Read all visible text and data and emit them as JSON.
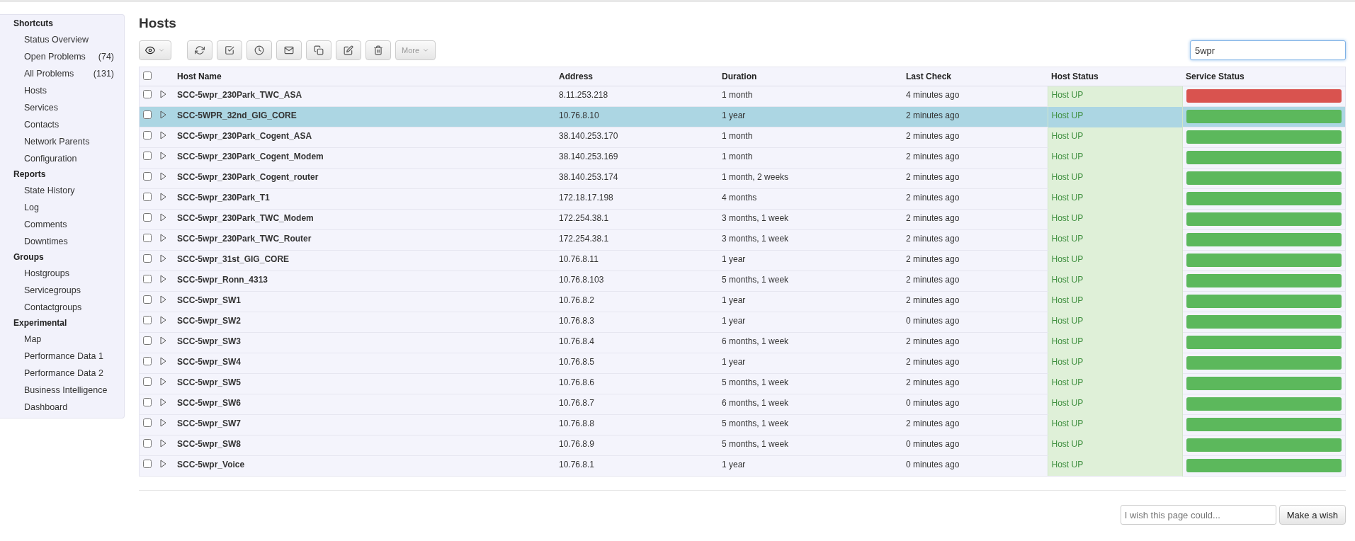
{
  "sidebar": {
    "sections": [
      {
        "title": "Shortcuts",
        "items": [
          {
            "label": "Status Overview"
          },
          {
            "label": "Open Problems",
            "count": "(74)"
          },
          {
            "label": "All Problems",
            "count": "(131)"
          },
          {
            "label": "Hosts"
          },
          {
            "label": "Services"
          },
          {
            "label": "Contacts"
          },
          {
            "label": "Network Parents"
          },
          {
            "label": "Configuration"
          }
        ]
      },
      {
        "title": "Reports",
        "items": [
          {
            "label": "State History"
          },
          {
            "label": "Log"
          },
          {
            "label": "Comments"
          },
          {
            "label": "Downtimes"
          }
        ]
      },
      {
        "title": "Groups",
        "items": [
          {
            "label": "Hostgroups"
          },
          {
            "label": "Servicegroups"
          },
          {
            "label": "Contactgroups"
          }
        ]
      },
      {
        "title": "Experimental",
        "items": [
          {
            "label": "Map"
          },
          {
            "label": "Performance Data 1"
          },
          {
            "label": "Performance Data 2"
          },
          {
            "label": "Business Intelligence"
          },
          {
            "label": "Dashboard"
          }
        ]
      }
    ]
  },
  "page": {
    "title": "Hosts"
  },
  "toolbar": {
    "buttons": [
      {
        "kind": "view"
      },
      {
        "kind": "refresh"
      },
      {
        "kind": "acknowledge"
      },
      {
        "kind": "schedule"
      },
      {
        "kind": "notify"
      },
      {
        "kind": "copy"
      },
      {
        "kind": "edit"
      },
      {
        "kind": "delete"
      },
      {
        "kind": "more",
        "label": "More"
      }
    ]
  },
  "search": {
    "value": "5wpr"
  },
  "table": {
    "columns": [
      "Host Name",
      "Address",
      "Duration",
      "Last Check",
      "Host Status",
      "Service Status"
    ],
    "all_checked": false,
    "rows": [
      {
        "name": "SCC-5wpr_230Park_TWC_ASA",
        "address": "8.11.253.218",
        "duration": "1 month",
        "last_check": "4 minutes ago",
        "host_status": "Host UP",
        "color": "#d9534f",
        "selected": false,
        "checked": false
      },
      {
        "name": "SCC-5WPR_32nd_GIG_CORE",
        "address": "10.76.8.10",
        "duration": "1 year",
        "last_check": "2 minutes ago",
        "host_status": "Host UP",
        "color": "#5cb85c",
        "selected": true,
        "checked": false
      },
      {
        "name": "SCC-5wpr_230Park_Cogent_ASA",
        "address": "38.140.253.170",
        "duration": "1 month",
        "last_check": "2 minutes ago",
        "host_status": "Host UP",
        "color": "#5cb85c",
        "selected": false,
        "checked": false
      },
      {
        "name": "SCC-5wpr_230Park_Cogent_Modem",
        "address": "38.140.253.169",
        "duration": "1 month",
        "last_check": "2 minutes ago",
        "host_status": "Host UP",
        "color": "#5cb85c",
        "selected": false,
        "checked": false
      },
      {
        "name": "SCC-5wpr_230Park_Cogent_router",
        "address": "38.140.253.174",
        "duration": "1 month, 2 weeks",
        "last_check": "2 minutes ago",
        "host_status": "Host UP",
        "color": "#5cb85c",
        "selected": false,
        "checked": false
      },
      {
        "name": "SCC-5wpr_230Park_T1",
        "address": "172.18.17.198",
        "duration": "4 months",
        "last_check": "2 minutes ago",
        "host_status": "Host UP",
        "color": "#5cb85c",
        "selected": false,
        "checked": false
      },
      {
        "name": "SCC-5wpr_230Park_TWC_Modem",
        "address": "172.254.38.1",
        "duration": "3 months, 1 week",
        "last_check": "2 minutes ago",
        "host_status": "Host UP",
        "color": "#5cb85c",
        "selected": false,
        "checked": false
      },
      {
        "name": "SCC-5wpr_230Park_TWC_Router",
        "address": "172.254.38.1",
        "duration": "3 months, 1 week",
        "last_check": "2 minutes ago",
        "host_status": "Host UP",
        "color": "#5cb85c",
        "selected": false,
        "checked": false
      },
      {
        "name": "SCC-5wpr_31st_GIG_CORE",
        "address": "10.76.8.11",
        "duration": "1 year",
        "last_check": "2 minutes ago",
        "host_status": "Host UP",
        "color": "#5cb85c",
        "selected": false,
        "checked": false
      },
      {
        "name": "SCC-5wpr_Ronn_4313",
        "address": "10.76.8.103",
        "duration": "5 months, 1 week",
        "last_check": "2 minutes ago",
        "host_status": "Host UP",
        "color": "#5cb85c",
        "selected": false,
        "checked": false
      },
      {
        "name": "SCC-5wpr_SW1",
        "address": "10.76.8.2",
        "duration": "1 year",
        "last_check": "2 minutes ago",
        "host_status": "Host UP",
        "color": "#5cb85c",
        "selected": false,
        "checked": false
      },
      {
        "name": "SCC-5wpr_SW2",
        "address": "10.76.8.3",
        "duration": "1 year",
        "last_check": "0 minutes ago",
        "host_status": "Host UP",
        "color": "#5cb85c",
        "selected": false,
        "checked": false
      },
      {
        "name": "SCC-5wpr_SW3",
        "address": "10.76.8.4",
        "duration": "6 months, 1 week",
        "last_check": "2 minutes ago",
        "host_status": "Host UP",
        "color": "#5cb85c",
        "selected": false,
        "checked": false
      },
      {
        "name": "SCC-5wpr_SW4",
        "address": "10.76.8.5",
        "duration": "1 year",
        "last_check": "2 minutes ago",
        "host_status": "Host UP",
        "color": "#5cb85c",
        "selected": false,
        "checked": false
      },
      {
        "name": "SCC-5wpr_SW5",
        "address": "10.76.8.6",
        "duration": "5 months, 1 week",
        "last_check": "2 minutes ago",
        "host_status": "Host UP",
        "color": "#5cb85c",
        "selected": false,
        "checked": false
      },
      {
        "name": "SCC-5wpr_SW6",
        "address": "10.76.8.7",
        "duration": "6 months, 1 week",
        "last_check": "0 minutes ago",
        "host_status": "Host UP",
        "color": "#5cb85c",
        "selected": false,
        "checked": false
      },
      {
        "name": "SCC-5wpr_SW7",
        "address": "10.76.8.8",
        "duration": "5 months, 1 week",
        "last_check": "2 minutes ago",
        "host_status": "Host UP",
        "color": "#5cb85c",
        "selected": false,
        "checked": false
      },
      {
        "name": "SCC-5wpr_SW8",
        "address": "10.76.8.9",
        "duration": "5 months, 1 week",
        "last_check": "0 minutes ago",
        "host_status": "Host UP",
        "color": "#5cb85c",
        "selected": false,
        "checked": false
      },
      {
        "name": "SCC-5wpr_Voice",
        "address": "10.76.8.1",
        "duration": "1 year",
        "last_check": "0 minutes ago",
        "host_status": "Host UP",
        "color": "#5cb85c",
        "selected": false,
        "checked": false
      }
    ]
  },
  "footer": {
    "wish_placeholder": "I wish this page could...",
    "wish_button": "Make a wish"
  }
}
